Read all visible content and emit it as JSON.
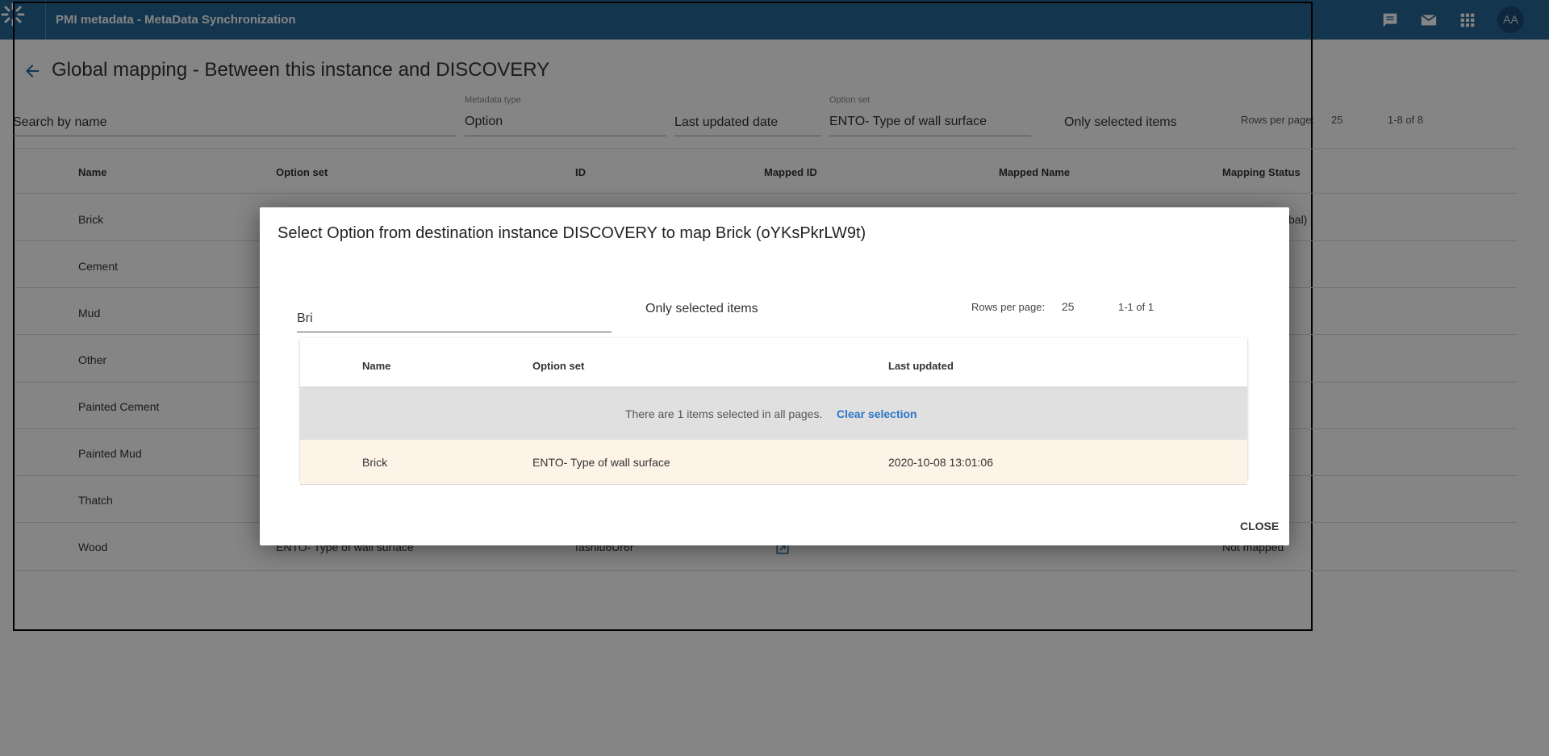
{
  "header": {
    "app_title": "PMI metadata - MetaData Synchronization",
    "user_initials": "AA",
    "icons": [
      "messages-icon",
      "mail-icon",
      "apps-icon"
    ]
  },
  "page": {
    "title": "Global mapping - Between this instance and DISCOVERY",
    "filters": {
      "search_placeholder": "Search by name",
      "metadata_type_label": "Metadata type",
      "metadata_type_value": "Option",
      "last_updated_placeholder": "Last updated date",
      "option_set_label": "Option set",
      "option_set_value": "ENTO- Type of wall surface",
      "only_selected": "Only selected items",
      "rows_per_page_label": "Rows per page:",
      "rows_per_page_value": "25",
      "range": "1-8 of 8"
    },
    "table": {
      "columns": [
        "Name",
        "Option set",
        "ID",
        "Mapped ID",
        "Mapped Name",
        "Mapping Status"
      ],
      "rows": [
        {
          "name": "Brick",
          "status": "bal)"
        },
        {
          "name": "Cement"
        },
        {
          "name": "Mud"
        },
        {
          "name": "Other"
        },
        {
          "name": "Painted Cement"
        },
        {
          "name": "Painted Mud"
        },
        {
          "name": "Thatch"
        },
        {
          "name": "Wood",
          "option_set": "ENTO- Type of wall surface",
          "id": "fashiu6Ur6r",
          "status": "Not mapped"
        }
      ]
    }
  },
  "dialog": {
    "title": "Select Option from destination instance DISCOVERY to map Brick (oYKsPkrLW9t)",
    "search_value": "Bri",
    "only_selected": "Only selected items",
    "rows_per_page_label": "Rows per page:",
    "rows_per_page_value": "25",
    "range": "1-1 of 1",
    "columns": [
      "Name",
      "Option set",
      "Last updated"
    ],
    "selection_text": "There are 1 items selected in all pages.",
    "clear_selection": "Clear selection",
    "rows": [
      {
        "name": "Brick",
        "option_set": "ENTO- Type of wall surface",
        "last_updated": "2020-10-08 13:01:06"
      }
    ],
    "close_label": "CLOSE"
  },
  "colors": {
    "header_bg": "#276696",
    "overlay": "rgba(0,0,0,0.48)",
    "link": "#2b74c7",
    "selected_row": "#fdf4e7",
    "banner": "#e0e0e0"
  }
}
